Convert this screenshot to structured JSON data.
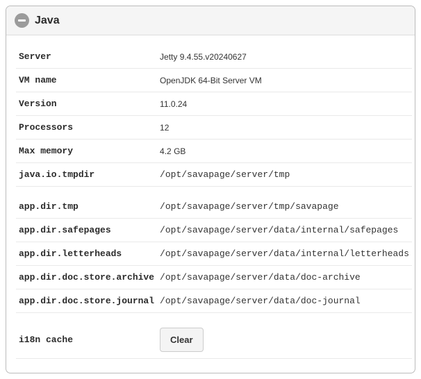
{
  "panel": {
    "title": "Java"
  },
  "rows1": [
    {
      "label": "Server",
      "value": "Jetty 9.4.55.v20240627",
      "mono": false
    },
    {
      "label": "VM name",
      "value": "OpenJDK 64-Bit Server VM",
      "mono": false
    },
    {
      "label": "Version",
      "value": "11.0.24",
      "mono": false
    },
    {
      "label": "Processors",
      "value": "12",
      "mono": false
    },
    {
      "label": "Max memory",
      "value": "4.2 GB",
      "mono": false
    },
    {
      "label": "java.io.tmpdir",
      "value": "/opt/savapage/server/tmp",
      "mono": true
    }
  ],
  "rows2": [
    {
      "label": "app.dir.tmp",
      "value": "/opt/savapage/server/tmp/savapage",
      "mono": true
    },
    {
      "label": "app.dir.safepages",
      "value": "/opt/savapage/server/data/internal/safepages",
      "mono": true
    },
    {
      "label": "app.dir.letterheads",
      "value": "/opt/savapage/server/data/internal/letterheads",
      "mono": true
    },
    {
      "label": "app.dir.doc.store.archive",
      "value": "/opt/savapage/server/data/doc-archive",
      "mono": true
    },
    {
      "label": "app.dir.doc.store.journal",
      "value": "/opt/savapage/server/data/doc-journal",
      "mono": true
    }
  ],
  "cache": {
    "label": "i18n cache",
    "button": "Clear"
  }
}
